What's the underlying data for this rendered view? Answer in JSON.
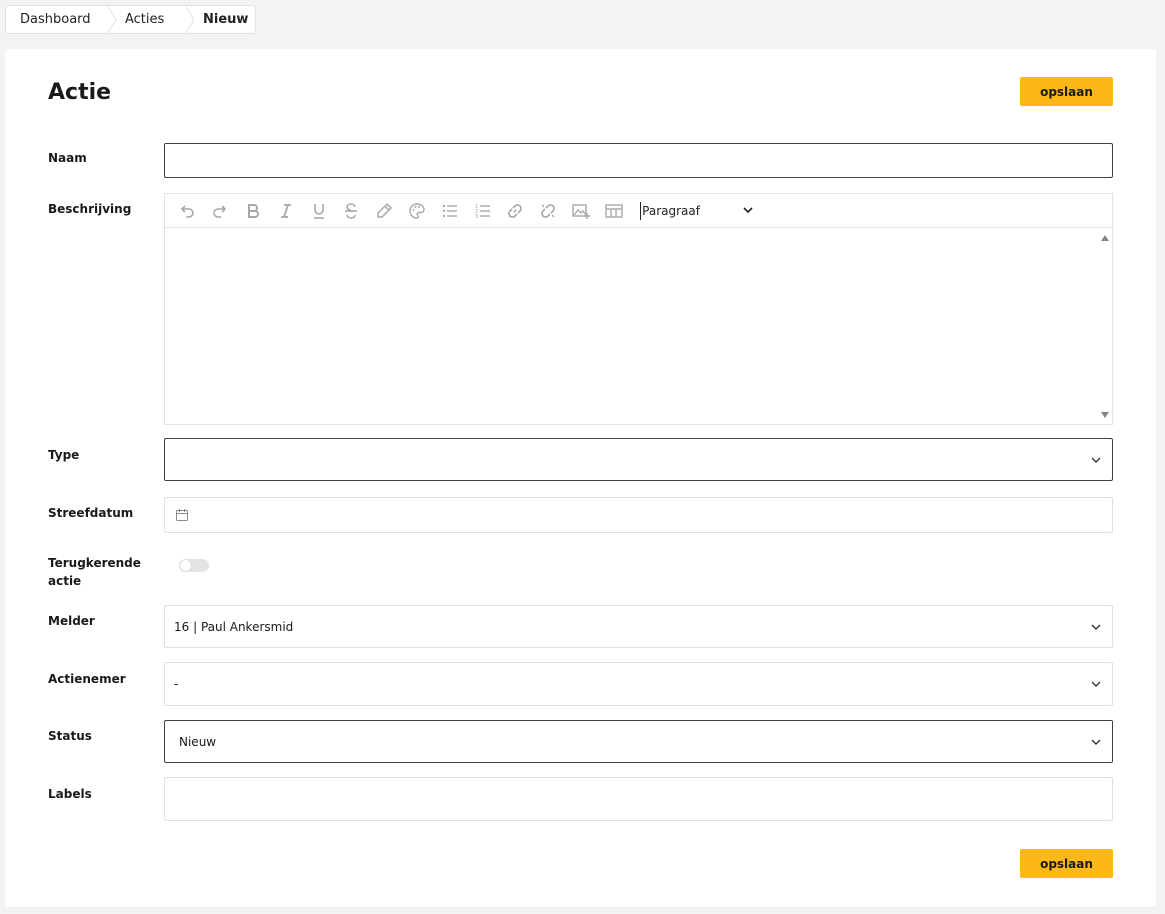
{
  "breadcrumb": {
    "items": [
      "Dashboard",
      "Acties",
      "Nieuw"
    ]
  },
  "page": {
    "title": "Actie",
    "save_label": "opslaan"
  },
  "form": {
    "naam": {
      "label": "Naam",
      "value": ""
    },
    "beschrijving": {
      "label": "Beschrijving",
      "paragraph_select": "Paragraaf",
      "toolbar_icons": [
        "undo-icon",
        "redo-icon",
        "bold-icon",
        "italic-icon",
        "underline-icon",
        "strikethrough-icon",
        "highlight-icon",
        "palette-icon",
        "bullet-list-icon",
        "numbered-list-icon",
        "link-icon",
        "unlink-icon",
        "insert-image-icon",
        "table-icon"
      ]
    },
    "type": {
      "label": "Type",
      "value": ""
    },
    "streefdatum": {
      "label": "Streefdatum",
      "value": ""
    },
    "terugkerende": {
      "label_line1": "Terugkerende",
      "label_line2": "actie",
      "checked": false
    },
    "melder": {
      "label": "Melder",
      "value": "16 | Paul Ankersmid"
    },
    "actienemer": {
      "label": "Actienemer",
      "value": "-"
    },
    "status": {
      "label": "Status",
      "value": "Nieuw"
    },
    "labels": {
      "label": "Labels",
      "value": ""
    }
  },
  "colors": {
    "accent": "#fbb816",
    "background": "#f3f3f3",
    "icon_gray": "#a8a8a8"
  }
}
